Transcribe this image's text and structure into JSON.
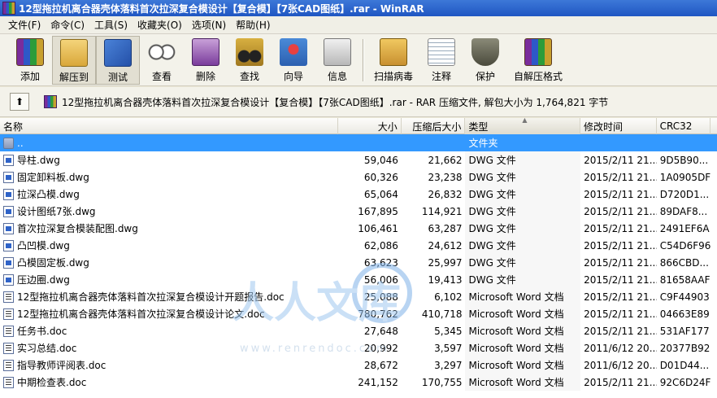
{
  "window": {
    "title": "12型拖拉机离合器壳体落料首次拉深复合模设计【复合模】【7张CAD图纸】.rar - WinRAR"
  },
  "menu": [
    "文件(F)",
    "命令(C)",
    "工具(S)",
    "收藏夹(O)",
    "选项(N)",
    "帮助(H)"
  ],
  "toolbar": {
    "add": "添加",
    "extract": "解压到",
    "test": "测试",
    "view": "查看",
    "delete": "删除",
    "find": "查找",
    "wizard": "向导",
    "info": "信息",
    "virus": "扫描病毒",
    "comment": "注释",
    "protect": "保护",
    "sfx": "自解压格式"
  },
  "address": {
    "up_glyph": "⬆",
    "text": "12型拖拉机离合器壳体落料首次拉深复合模设计【复合模】【7张CAD图纸】.rar - RAR 压缩文件, 解包大小为 1,764,821 字节"
  },
  "columns": {
    "name": "名称",
    "size": "大小",
    "packed": "压缩后大小",
    "type": "类型",
    "modified": "修改时间",
    "crc": "CRC32"
  },
  "files": [
    {
      "icon": "folder",
      "name": "..",
      "size": "",
      "packed": "",
      "type": "文件夹",
      "modified": "",
      "crc": ""
    },
    {
      "icon": "dwg",
      "name": "导柱.dwg",
      "size": "59,046",
      "packed": "21,662",
      "type": "DWG 文件",
      "modified": "2015/2/11 21...",
      "crc": "9D5B90..."
    },
    {
      "icon": "dwg",
      "name": "固定卸料板.dwg",
      "size": "60,326",
      "packed": "23,238",
      "type": "DWG 文件",
      "modified": "2015/2/11 21...",
      "crc": "1A0905DF"
    },
    {
      "icon": "dwg",
      "name": "拉深凸模.dwg",
      "size": "65,064",
      "packed": "26,832",
      "type": "DWG 文件",
      "modified": "2015/2/11 21...",
      "crc": "D720D1..."
    },
    {
      "icon": "dwg",
      "name": "设计图纸7张.dwg",
      "size": "167,895",
      "packed": "114,921",
      "type": "DWG 文件",
      "modified": "2015/2/11 21...",
      "crc": "89DAF8..."
    },
    {
      "icon": "dwg",
      "name": "首次拉深复合模装配图.dwg",
      "size": "106,461",
      "packed": "63,287",
      "type": "DWG 文件",
      "modified": "2015/2/11 21...",
      "crc": "2491EF6A"
    },
    {
      "icon": "dwg",
      "name": "凸凹模.dwg",
      "size": "62,086",
      "packed": "24,612",
      "type": "DWG 文件",
      "modified": "2015/2/11 21...",
      "crc": "C54D6F96"
    },
    {
      "icon": "dwg",
      "name": "凸模固定板.dwg",
      "size": "63,623",
      "packed": "25,997",
      "type": "DWG 文件",
      "modified": "2015/2/11 21...",
      "crc": "866CBD..."
    },
    {
      "icon": "dwg",
      "name": "压边圈.dwg",
      "size": "56,006",
      "packed": "19,413",
      "type": "DWG 文件",
      "modified": "2015/2/11 21...",
      "crc": "81658AAF"
    },
    {
      "icon": "doc",
      "name": "12型拖拉机离合器壳体落料首次拉深复合模设计开题报告.doc",
      "size": "25,088",
      "packed": "6,102",
      "type": "Microsoft Word 文档",
      "modified": "2015/2/11 21...",
      "crc": "C9F44903"
    },
    {
      "icon": "doc",
      "name": "12型拖拉机离合器壳体落料首次拉深复合模设计论文.doc",
      "size": "780,762",
      "packed": "410,718",
      "type": "Microsoft Word 文档",
      "modified": "2015/2/11 21...",
      "crc": "04663E89"
    },
    {
      "icon": "doc",
      "name": "任务书.doc",
      "size": "27,648",
      "packed": "5,345",
      "type": "Microsoft Word 文档",
      "modified": "2015/2/11 21...",
      "crc": "531AF177"
    },
    {
      "icon": "doc",
      "name": "实习总结.doc",
      "size": "20,992",
      "packed": "3,597",
      "type": "Microsoft Word 文档",
      "modified": "2011/6/12 20...",
      "crc": "20377B92"
    },
    {
      "icon": "doc",
      "name": "指导教师评阅表.doc",
      "size": "28,672",
      "packed": "3,297",
      "type": "Microsoft Word 文档",
      "modified": "2011/6/12 20...",
      "crc": "D01D44..."
    },
    {
      "icon": "doc",
      "name": "中期检查表.doc",
      "size": "241,152",
      "packed": "170,755",
      "type": "Microsoft Word 文档",
      "modified": "2015/2/11 21...",
      "crc": "92C6D24F"
    }
  ],
  "watermark": {
    "text": "人人文库",
    "url": "www.renrendoc.com"
  }
}
